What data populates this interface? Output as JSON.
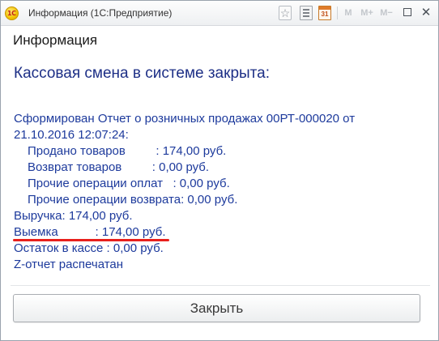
{
  "window": {
    "title": "Информация  (1С:Предприятие)",
    "logo_text": "1С",
    "toolbar": {
      "star_icon": "star-icon",
      "calendar_day": "31",
      "m_label": "M",
      "m_plus_label": "M+",
      "m_minus_label": "M−",
      "close_glyph": "✕"
    }
  },
  "form": {
    "title": "Информация",
    "headline": "Кассовая смена в системе закрыта:",
    "report_lines": [
      "Сформирован Отчет о розничных продажах 00РТ-000020 от",
      "21.10.2016 12:07:24:",
      "Продано товаров         : 174,00 руб.",
      "Возврат товаров         : 0,00 руб.",
      "Прочие операции оплат   : 0,00 руб.",
      "Прочие операции возврата: 0,00 руб.",
      "Выручка: 174,00 руб.",
      "Выемка           : 174,00 руб.",
      "Остаток в кассе : 0,00 руб.",
      "Z-отчет распечатан"
    ],
    "close_button_label": "Закрыть"
  },
  "colors": {
    "headline": "#1d2f86",
    "report_text": "#1d3a9c",
    "highlight_underline": "#e8201c"
  }
}
